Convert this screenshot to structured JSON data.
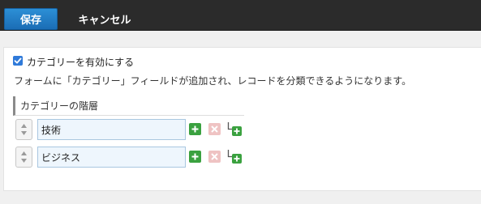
{
  "toolbar": {
    "save_label": "保存",
    "cancel_label": "キャンセル"
  },
  "settings": {
    "enable_checked": true,
    "enable_label": "カテゴリーを有効にする",
    "description": "フォームに「カテゴリー」フィールドが追加され、レコードを分類できるようになります。",
    "section_title": "カテゴリーの階層"
  },
  "categories": [
    {
      "value": "技術"
    },
    {
      "value": "ビジネス"
    }
  ],
  "colors": {
    "save_button": "#1b6db5",
    "checkbox": "#2f7ad9",
    "add_button": "#3aa13f",
    "delete_button": "#efc3c3",
    "input_background": "#eef6fd"
  },
  "icons": {
    "sort": "sort-arrows-icon",
    "add": "plus-icon",
    "delete": "x-icon",
    "add_child": "add-child-icon"
  }
}
